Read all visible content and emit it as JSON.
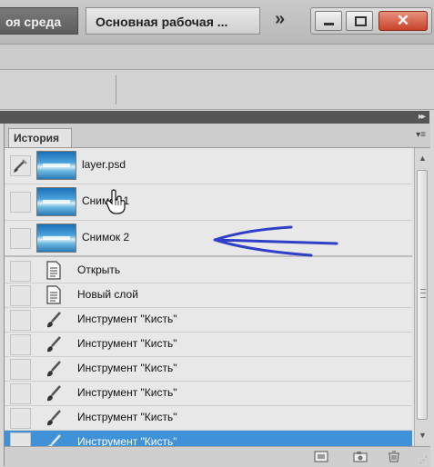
{
  "workspace": {
    "tab_dark": "оя среда",
    "tab_light": "Основная рабочая ...",
    "more": "»"
  },
  "panel": {
    "tab_label": "История"
  },
  "snapshots": [
    {
      "label": "layer.psd"
    },
    {
      "label": "Снимок 1"
    },
    {
      "label": "Снимок 2"
    }
  ],
  "history": [
    {
      "label": "Открыть",
      "icon": "document-icon"
    },
    {
      "label": "Новый слой",
      "icon": "document-icon"
    },
    {
      "label": "Инструмент \"Кисть\"",
      "icon": "brush-icon"
    },
    {
      "label": "Инструмент \"Кисть\"",
      "icon": "brush-icon"
    },
    {
      "label": "Инструмент \"Кисть\"",
      "icon": "brush-icon"
    },
    {
      "label": "Инструмент \"Кисть\"",
      "icon": "brush-icon"
    },
    {
      "label": "Инструмент \"Кисть\"",
      "icon": "brush-icon"
    },
    {
      "label": "Инструмент \"Кисть\"",
      "icon": "brush-icon",
      "selected": true
    }
  ],
  "colors": {
    "selection": "#3f92d8",
    "annotation_arrow": "#2f3fc8",
    "close_button": "#c7432b"
  }
}
